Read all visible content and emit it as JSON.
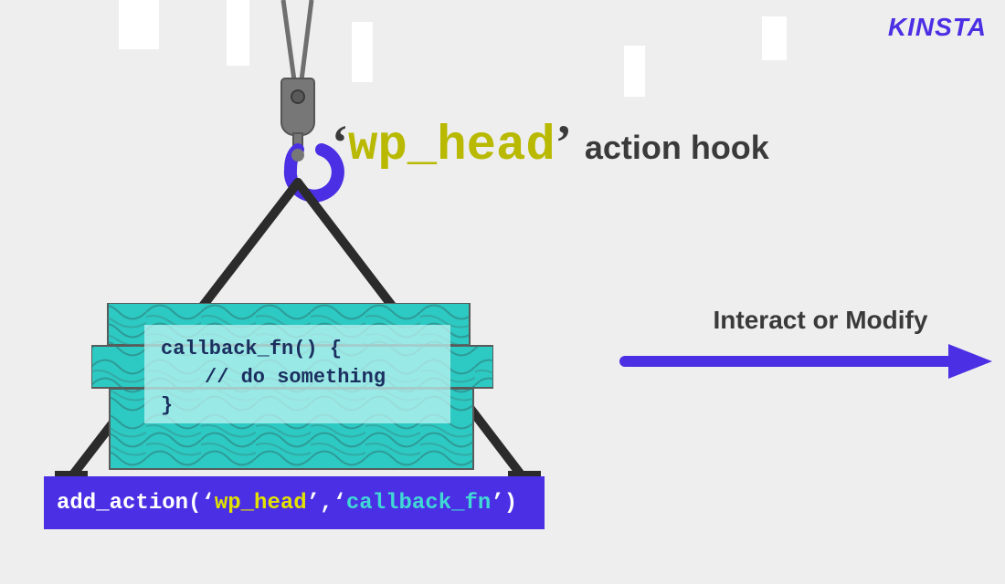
{
  "brand": {
    "logo_text": "KINSTA"
  },
  "title": {
    "quote_open": "‘",
    "hook_name": "wp_head",
    "quote_close": "’",
    "suffix": "action hook"
  },
  "callback": {
    "line1": "callback_fn() {",
    "line2": "// do something",
    "line3": "}"
  },
  "add_action": {
    "prefix": "add_action( ",
    "q1": "‘",
    "arg1": "wp_head",
    "q1c": "’",
    "sep": ", ",
    "q2": "‘",
    "arg2": "callback_fn",
    "q2c": "’",
    "suffix": " )"
  },
  "arrow": {
    "label": "Interact or Modify"
  }
}
